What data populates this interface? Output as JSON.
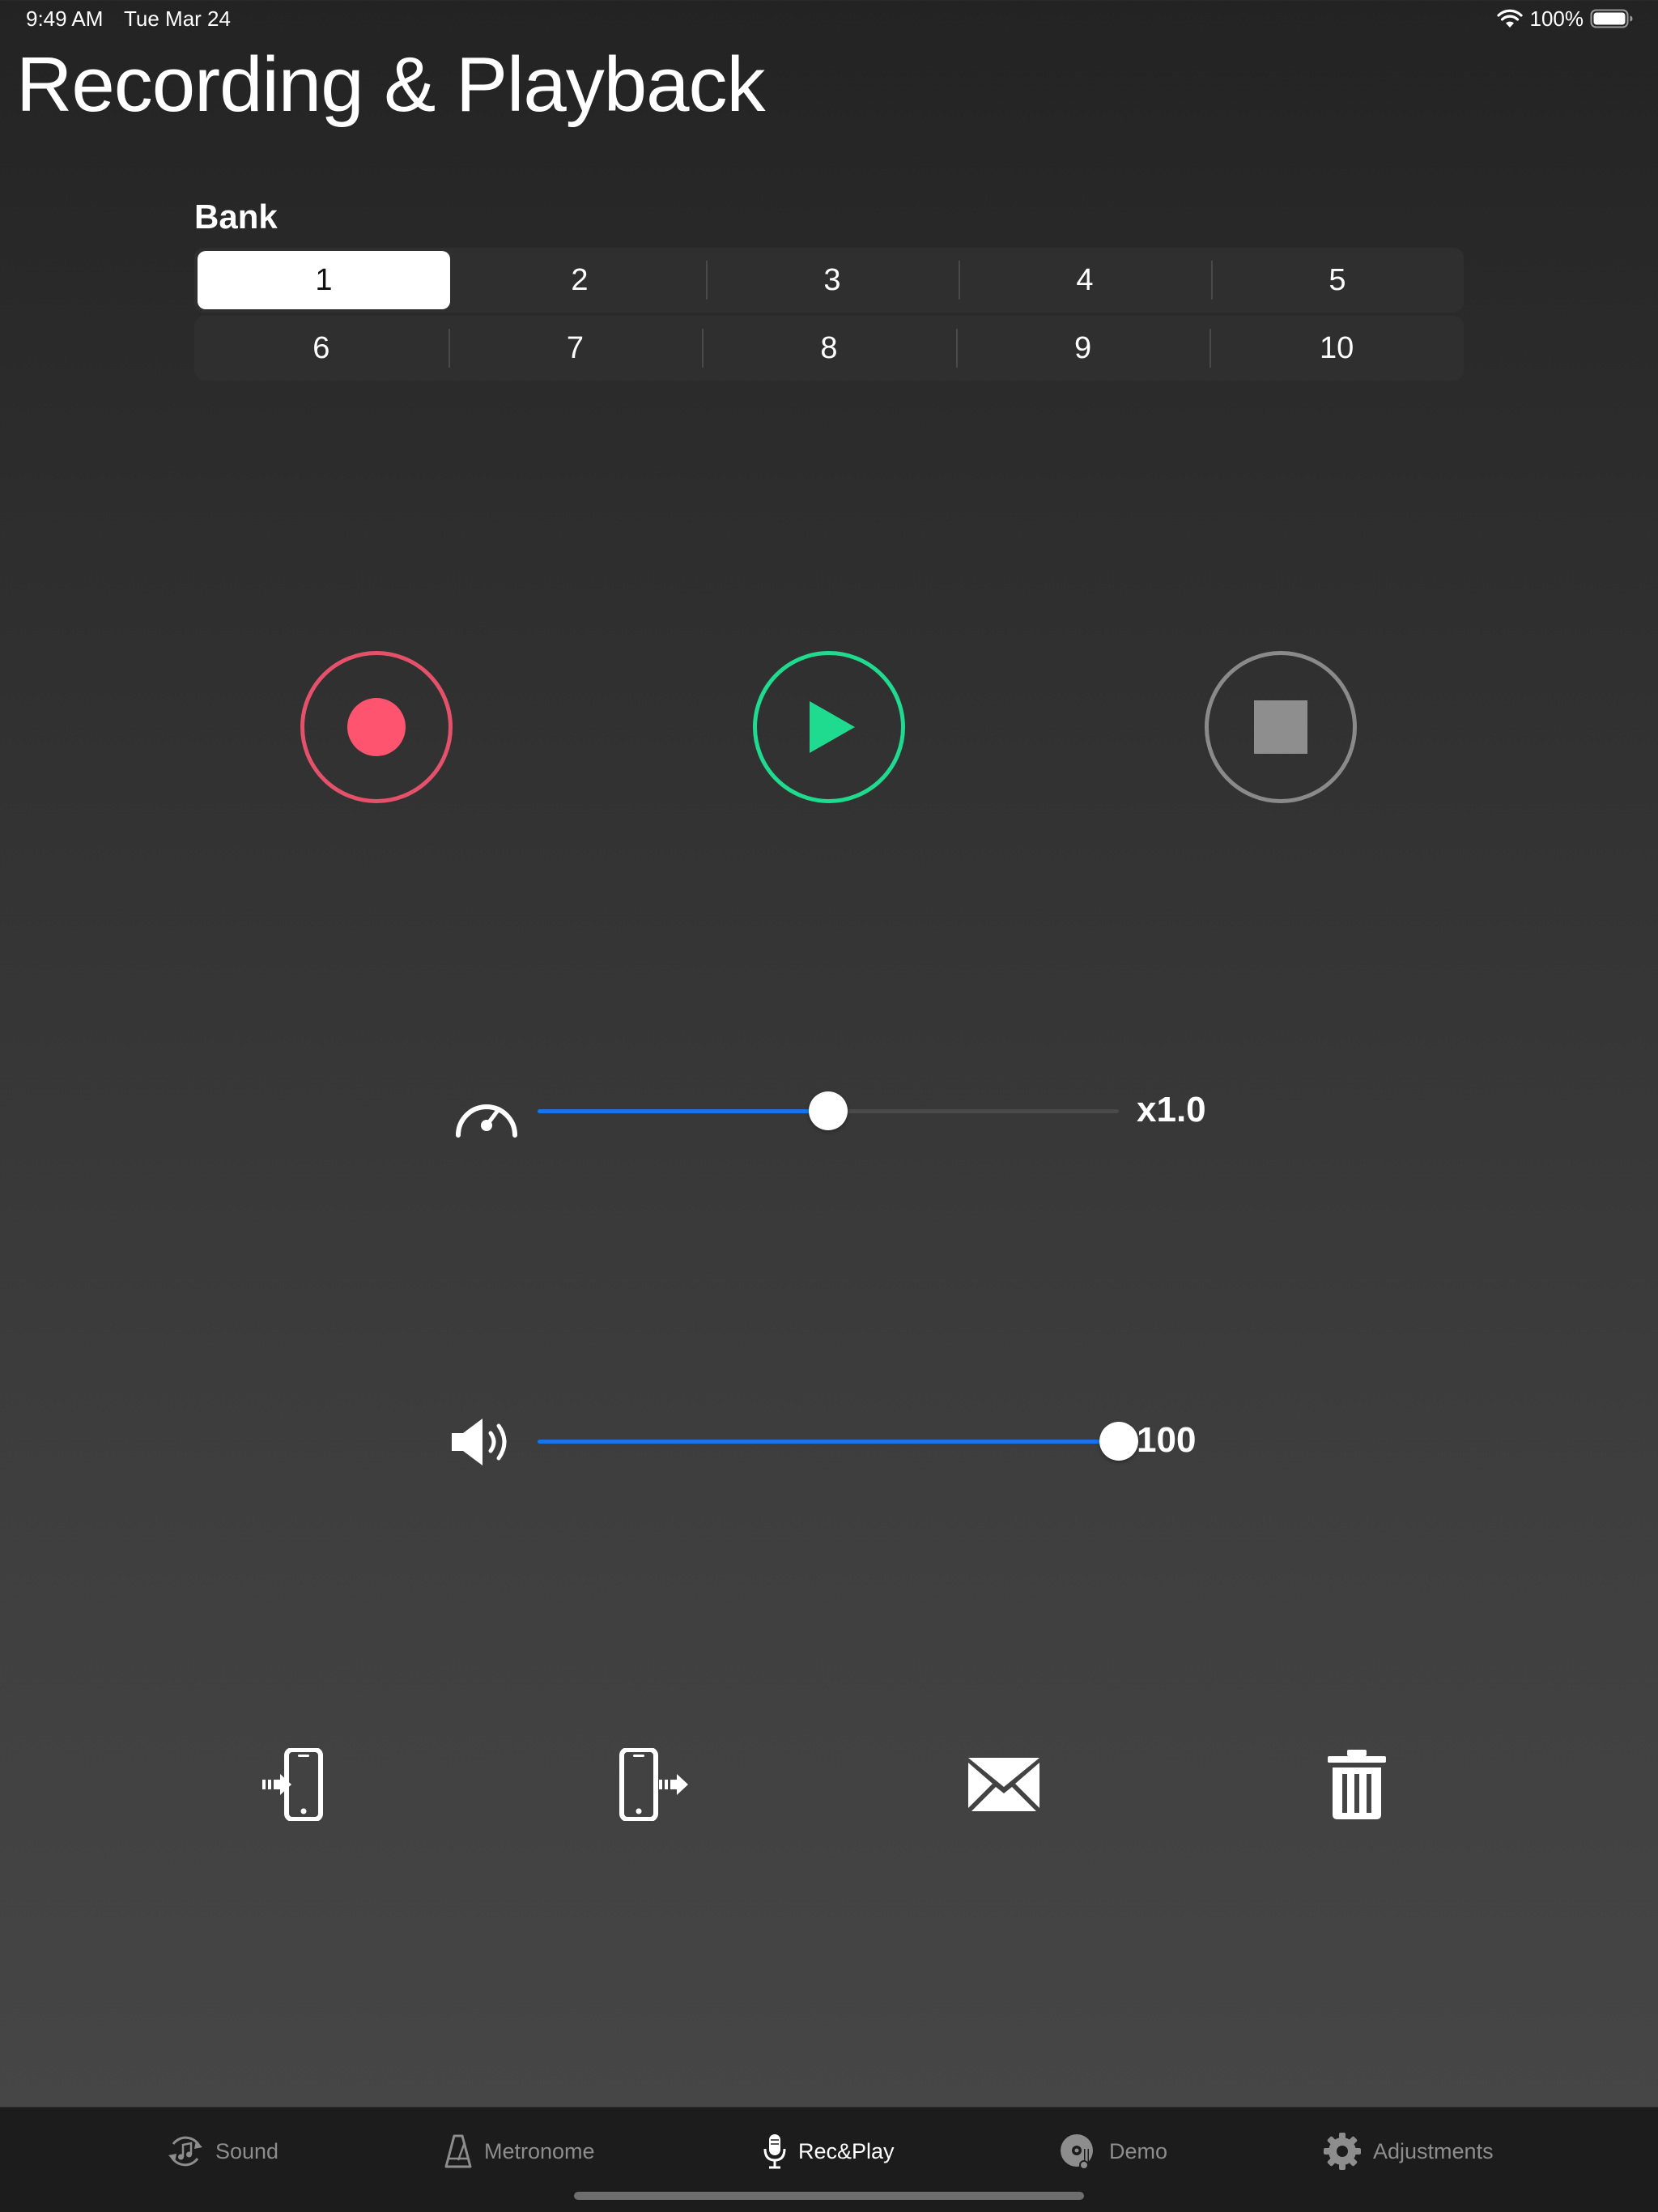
{
  "status_bar": {
    "time": "9:49 AM",
    "date": "Tue Mar 24",
    "battery": "100%"
  },
  "title": "Recording & Playback",
  "bank": {
    "label": "Bank",
    "selected": "1",
    "row1": [
      "1",
      "2",
      "3",
      "4",
      "5"
    ],
    "row2": [
      "6",
      "7",
      "8",
      "9",
      "10"
    ]
  },
  "transport": {
    "record_color": "#ff5470",
    "play_color": "#1fdb8f",
    "stop_color": "#8e8e8e"
  },
  "speed": {
    "value_label": "x1.0",
    "level_percent": 50,
    "icon": "speedometer-icon"
  },
  "volume": {
    "value_label": "100",
    "level_percent": 100,
    "icon": "speaker-icon"
  },
  "actions": [
    "import-to-device-icon",
    "export-from-device-icon",
    "mail-icon",
    "trash-icon"
  ],
  "tabs": [
    {
      "label": "Sound",
      "icon": "sound-icon"
    },
    {
      "label": "Metronome",
      "icon": "metronome-icon"
    },
    {
      "label": "Rec&Play",
      "icon": "microphone-icon",
      "active": true
    },
    {
      "label": "Demo",
      "icon": "demo-disc-icon"
    },
    {
      "label": "Adjustments",
      "icon": "gear-icon"
    }
  ],
  "accent_color": "#1a73e8"
}
